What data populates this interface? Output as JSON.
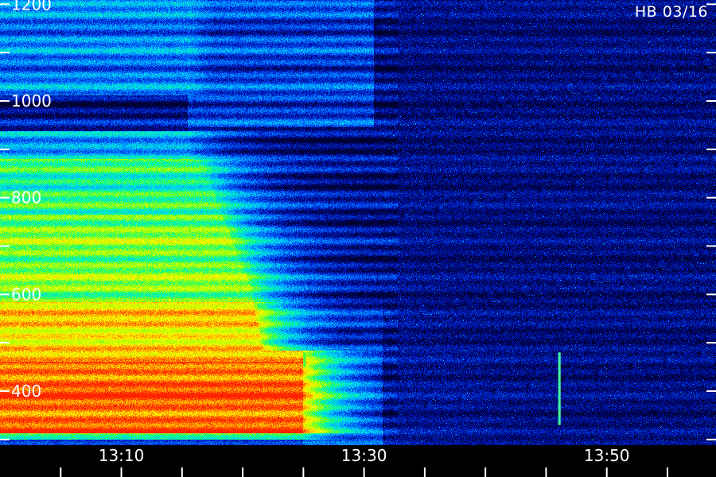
{
  "station_label": "HB 03/16",
  "chart_data": {
    "type": "heatmap",
    "title": "HB 03/16",
    "xlabel": "",
    "ylabel": "",
    "x_unit_labels": [
      "13:10",
      "13:30",
      "13:50"
    ],
    "x_ticks": [
      {
        "value": "13:10",
        "label": "13:10"
      },
      {
        "value": "13:30",
        "label": "13:30"
      },
      {
        "value": "13:50",
        "label": "13:50"
      }
    ],
    "x_minor_ticks": [
      "13:05",
      "13:15",
      "13:20",
      "13:25",
      "13:35",
      "13:40",
      "13:45",
      "13:55"
    ],
    "xlim": [
      "13:00",
      "13:59"
    ],
    "y_ticks": [
      {
        "value": 400,
        "label": "400"
      },
      {
        "value": 600,
        "label": "600"
      },
      {
        "value": 800,
        "label": "800"
      },
      {
        "value": 1000,
        "label": "1000"
      },
      {
        "value": 1200,
        "label": "1200"
      }
    ],
    "y_minor_ticks": [
      300,
      500,
      700,
      900,
      1100
    ],
    "ylim": [
      290,
      1200
    ],
    "colormap": [
      "#000028",
      "#0010b0",
      "#0060ff",
      "#00d0ff",
      "#00ff90",
      "#a0ff00",
      "#ffff00",
      "#ff9000",
      "#ff2000"
    ],
    "features": [
      {
        "kind": "strong-emission-band",
        "y_range": [
          380,
          470
        ],
        "x_range": [
          "13:00",
          "13:27"
        ],
        "level": 0.95
      },
      {
        "kind": "emission-band",
        "y_range": [
          470,
          580
        ],
        "x_range": [
          "13:00",
          "13:22"
        ],
        "level": 0.8
      },
      {
        "kind": "emission-band",
        "y_range": [
          580,
          860
        ],
        "x_range": [
          "13:00",
          "13:16"
        ],
        "level": 0.6
      },
      {
        "kind": "dark-gap",
        "y_range": [
          960,
          1020
        ],
        "x_range": [
          "13:00",
          "13:16"
        ],
        "level": 0.05
      },
      {
        "kind": "fading-edge",
        "x_range": [
          "13:16",
          "13:34"
        ],
        "level": 0.3
      },
      {
        "kind": "spike",
        "x": "13:25",
        "y_range": [
          450,
          480
        ],
        "color": "#40ff40"
      },
      {
        "kind": "spike",
        "x": "13:46",
        "y_range": [
          330,
          480
        ],
        "color": "#40ffa0"
      }
    ]
  }
}
